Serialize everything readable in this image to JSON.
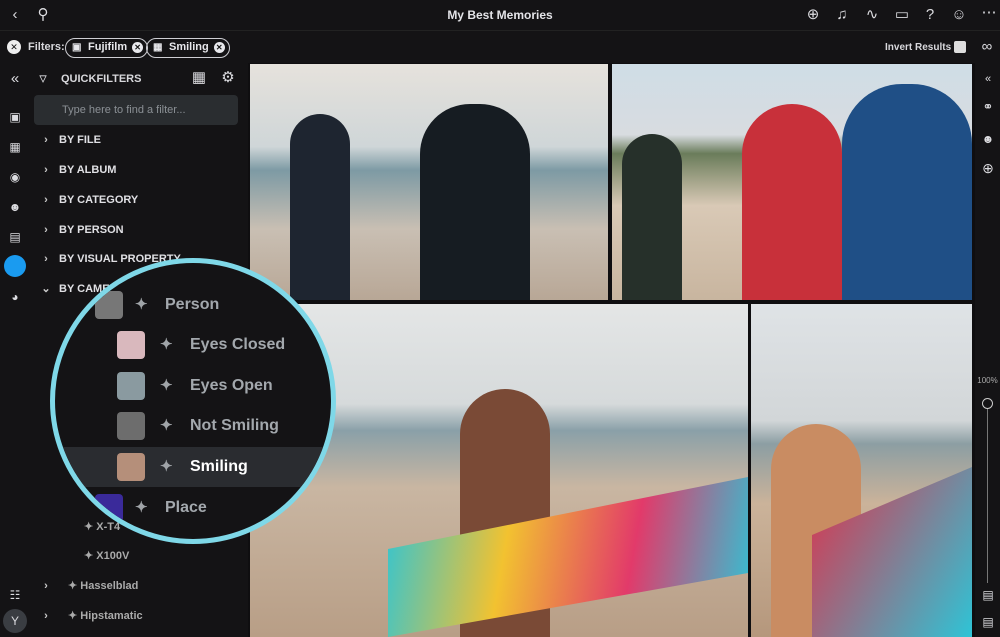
{
  "header": {
    "title": "My Best Memories"
  },
  "filters": {
    "label": "Filters:",
    "chips": [
      "Fujifilm",
      "Smiling"
    ],
    "invert": "Invert Results"
  },
  "sidebar": {
    "title": "QUICKFILTERS",
    "search_placeholder": "Type here to find a filter...",
    "groups": [
      "BY FILE",
      "BY ALBUM",
      "BY CATEGORY",
      "BY PERSON",
      "BY VISUAL PROPERTY",
      "BY CAMERA"
    ],
    "camera_items": [
      "X-T4",
      "X100V"
    ],
    "brands": [
      "Hasselblad",
      "Hipstamatic"
    ]
  },
  "magnifier": {
    "items": [
      "Person",
      "Eyes Closed",
      "Eyes Open",
      "Not Smiling",
      "Smiling",
      "Place"
    ],
    "selected": "Smiling"
  },
  "right_rail": {
    "zoom": "100%"
  },
  "colors": {
    "accent": "#1a9bf0",
    "magnifier": "#7fd8e8"
  }
}
